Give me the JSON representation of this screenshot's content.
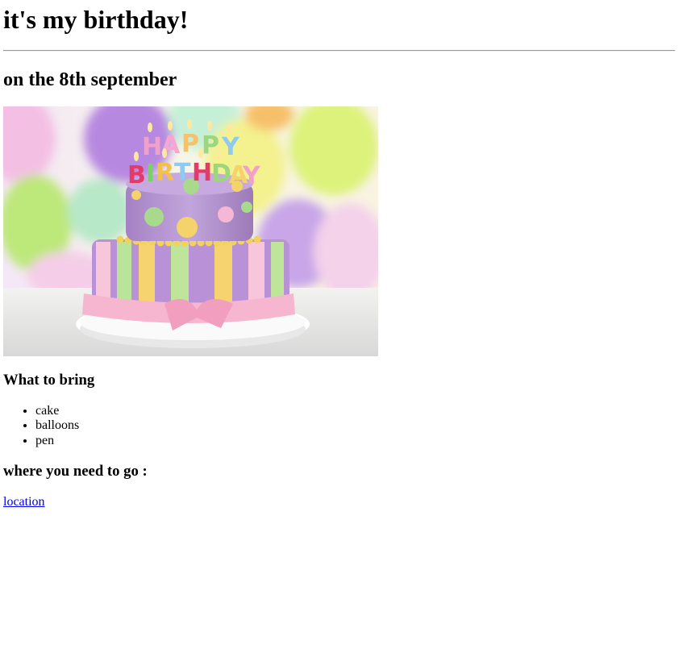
{
  "page": {
    "title": "it's my birthday!",
    "subtitle": "on the 8th september",
    "image": {
      "description": "birthday cake photo",
      "cake_lettering": "HAPPY BIRTHDAY"
    },
    "bring_heading": "What to bring",
    "bring_items": [
      "cake",
      "balloons",
      "pen"
    ],
    "where_heading": "where you need to go :",
    "location_link": "location"
  },
  "colors": {
    "link": "#0000ee",
    "rule": "#9a9a9a"
  }
}
